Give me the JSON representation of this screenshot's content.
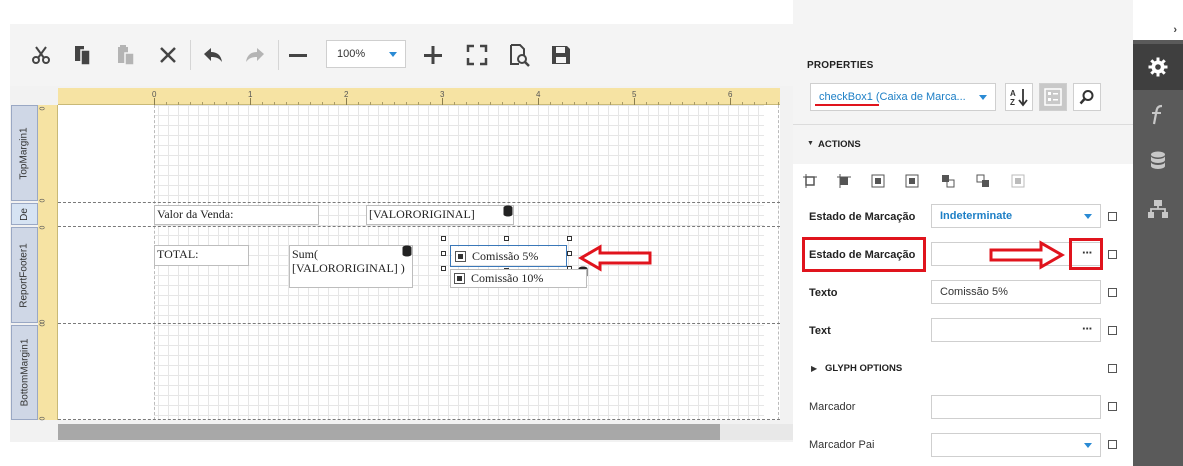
{
  "toolbar": {
    "zoom_value": "100%"
  },
  "ruler": {
    "top_numbers": [
      "0",
      "1",
      "2",
      "3",
      "4",
      "5",
      "6"
    ],
    "left_numbers": [
      "0",
      "0",
      "0",
      "0",
      "0",
      "0"
    ]
  },
  "bands": {
    "top_margin": "TopMargin1",
    "detail": "De",
    "report_footer": "ReportFooter1",
    "bottom_margin": "BottomMargin1"
  },
  "report": {
    "valor_label": "Valor da Venda:",
    "valor_field": "[VALORORIGINAL]",
    "total_label": "TOTAL:",
    "sum_line1": "Sum(",
    "sum_line2": "[VALORORIGINAL] )",
    "check1": "Comissão 5%",
    "check2": "Comissão 10%"
  },
  "panel": {
    "title": "PROPERTIES",
    "component": "checkBox1 (Caixa de Marca...",
    "actions_header": "ACTIONS",
    "glyph_header": "GLYPH OPTIONS",
    "rows": [
      {
        "label": "Estado de Marcação",
        "value": "Indeterminate"
      },
      {
        "label": "Estado de Marcação",
        "value": ""
      },
      {
        "label": "Texto",
        "value": "Comissão 5%"
      },
      {
        "label": "Text",
        "value": ""
      },
      {
        "label": "Marcador",
        "value": ""
      },
      {
        "label": "Marcador Pai",
        "value": ""
      }
    ]
  },
  "colors": {
    "accent": "#1d7fc6",
    "annotation_red": "#e0141d",
    "ruler": "#f6e3a3",
    "sidebar": "#5a5a5a"
  }
}
